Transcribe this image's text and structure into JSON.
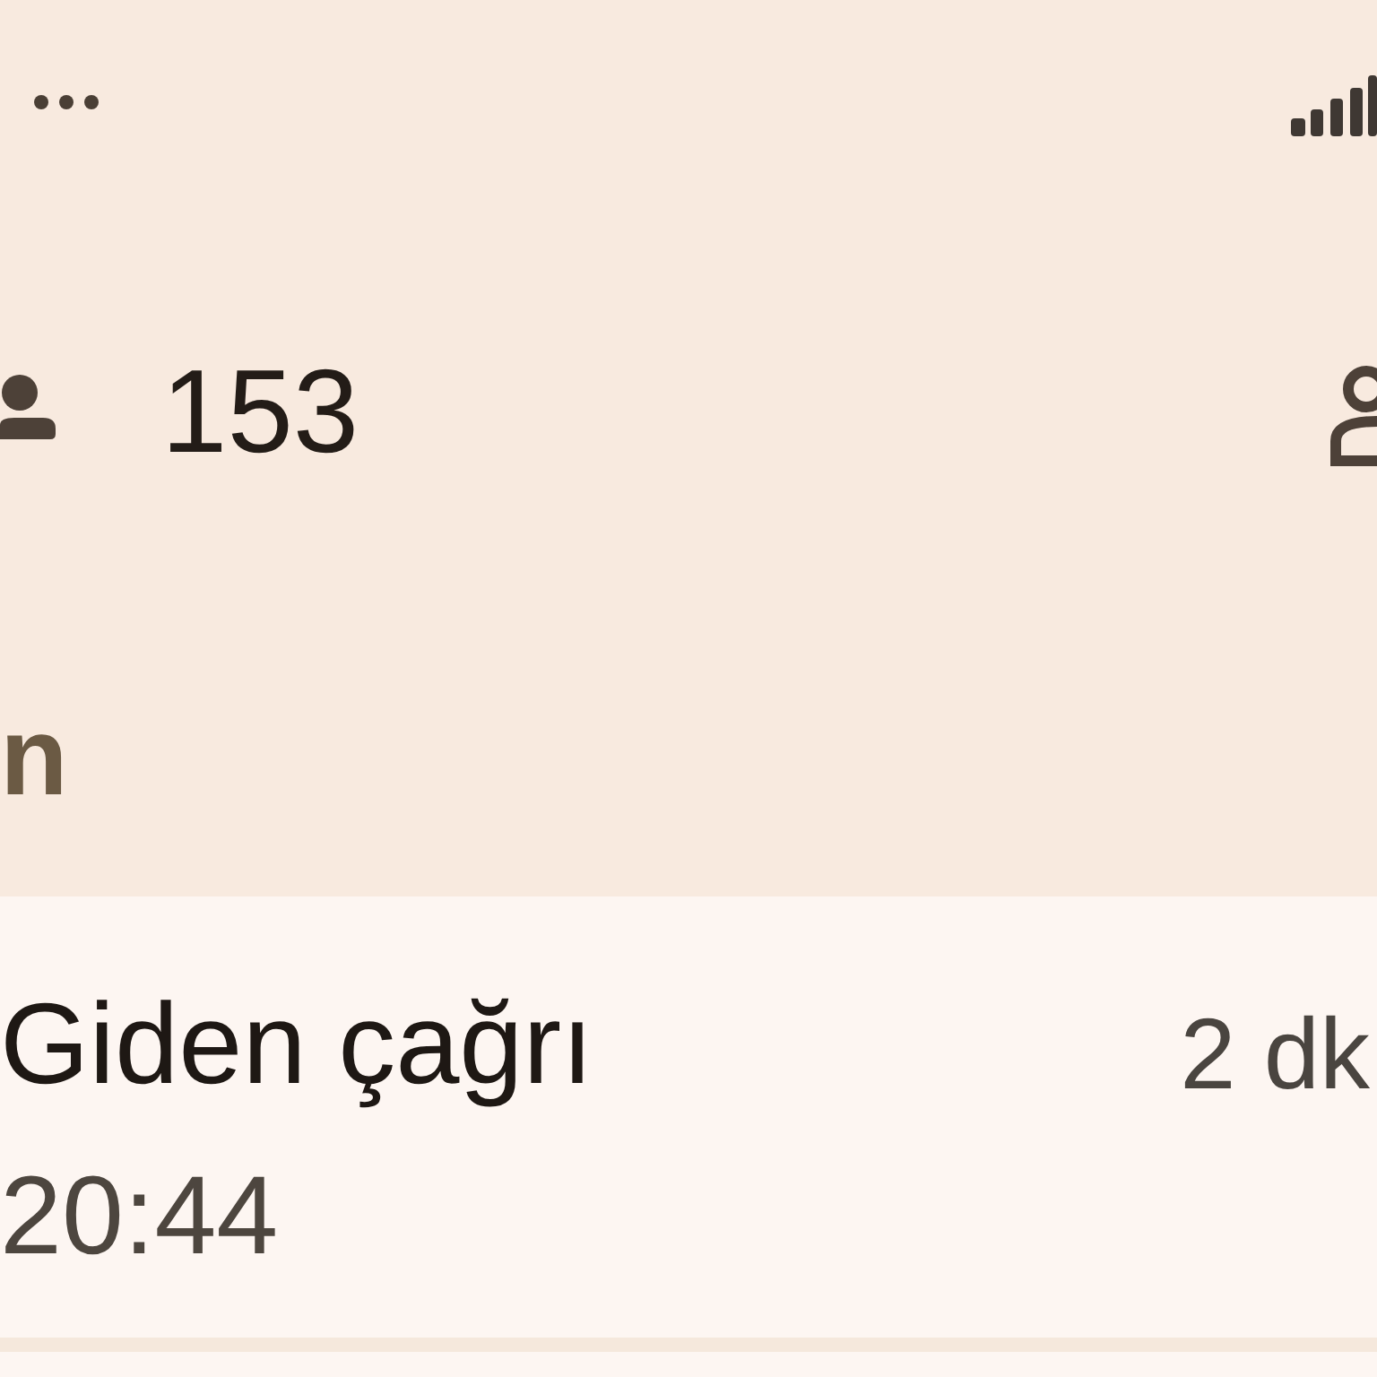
{
  "header": {
    "contact_count": "153"
  },
  "section": {
    "title": "n"
  },
  "call_log": [
    {
      "type": "Giden çağrı",
      "time": "20:44",
      "duration": "2 dk"
    }
  ]
}
